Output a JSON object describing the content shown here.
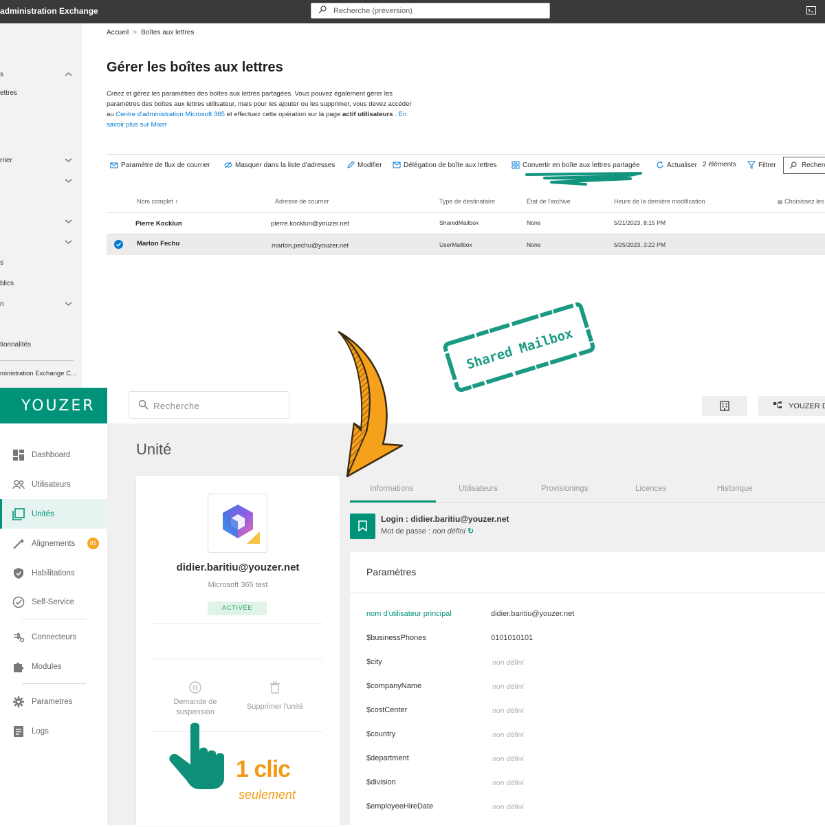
{
  "exchange": {
    "app_title": "administration Exchange",
    "search_placeholder": "Recherche (préversion)",
    "sidebar_items": [
      {
        "label": "s",
        "chevron": true
      },
      {
        "label": "ettres",
        "chevron": false
      },
      {
        "label": "rrier",
        "chevron": true
      },
      {
        "label": "",
        "chevron": true
      },
      {
        "label": "",
        "chevron": true
      },
      {
        "label": "",
        "chevron": true
      },
      {
        "label": "s",
        "chevron": false
      },
      {
        "label": "blics",
        "chevron": false
      },
      {
        "label": "n",
        "chevron": true
      },
      {
        "label": "tionnalités",
        "chevron": false
      },
      {
        "label": "ministration Exchange C...",
        "chevron": false
      }
    ],
    "breadcrumb": [
      "Accueil",
      ">",
      "Boîtes aux lettres"
    ],
    "page_title": "Gérer les boîtes aux lettres",
    "description": {
      "p1": "Créez et gérez les paramètres des boîtes aux lettres partagées. Vous pouvez également gérer les paramètres des boîtes aux lettres utilisateur, mais pour les ajouter ou les supprimer, vous devez accéder au ",
      "link1": "Centre d'administration Microsoft 365",
      "p2": " et effectuez cette opération sur la page ",
      "bold1": "actif utilisateurs",
      "p3": " . ",
      "link2": "En savoir plus sur Mixer"
    },
    "commands": [
      {
        "icon": "mail-flow-icon",
        "label": "Paramètre de flux de courrier"
      },
      {
        "icon": "hide-icon",
        "label": "Masquer dans la liste d'adresses"
      },
      {
        "icon": "edit-icon",
        "label": "Modifier"
      },
      {
        "icon": "delegation-icon",
        "label": "Délégation de boîte aux lettres"
      },
      {
        "icon": "convert-icon",
        "label": "Convertir en boîte aux lettres partagée"
      },
      {
        "icon": "refresh-icon",
        "label": "Actualiser"
      },
      {
        "icon": "",
        "label": "2 éléments"
      },
      {
        "icon": "filter-icon",
        "label": "Filtrer"
      }
    ],
    "table_search_placeholder": "Recherc",
    "columns": [
      "Nom complet",
      "Adresse de courrier",
      "Type de destinataire",
      "État de l'archive",
      "Heure de la dernière modification",
      "Choisissez les"
    ],
    "rows": [
      {
        "name": "Pierre Kocklun",
        "email": "pierre.kocklun@youzer.net",
        "type": "SharedMailbox",
        "archive": "None",
        "modified": "5/21/2023, 8:15 PM",
        "selected": false
      },
      {
        "name": "Marlon Fechu",
        "email": "marlon.pechu@youzer.net",
        "type": "UserMailbox",
        "archive": "None",
        "modified": "5/25/2023, 3:22 PM",
        "selected": true
      }
    ]
  },
  "annotations": {
    "stamp_text": "Shared Mailbox",
    "stamp_color": "#1a9a82",
    "arrow_color": "#f5a11c",
    "click_big": "1 clic",
    "click_small": "seulement",
    "hand_color": "#0e8f7a"
  },
  "youzer": {
    "logo": "YOUZER",
    "brand_color": "#00937a",
    "search_placeholder": "Recherche",
    "top_button": "YOUZER D",
    "nav": [
      {
        "icon": "dashboard-icon",
        "label": "Dashboard",
        "active": false
      },
      {
        "icon": "users-icon",
        "label": "Utilisateurs",
        "active": false
      },
      {
        "icon": "units-icon",
        "label": "Unités",
        "active": true
      },
      {
        "icon": "magic-wand-icon",
        "label": "Alignements",
        "active": false,
        "badge": "81"
      },
      {
        "icon": "shield-icon",
        "label": "Habilitations",
        "active": false
      },
      {
        "icon": "check-circle-icon",
        "label": "Self-Service",
        "active": false
      },
      {
        "icon": "connector-icon",
        "label": "Connecteurs",
        "active": false
      },
      {
        "icon": "puzzle-icon",
        "label": "Modules",
        "active": false
      },
      {
        "icon": "gear-icon",
        "label": "Parametres",
        "active": false
      },
      {
        "icon": "logs-icon",
        "label": "Logs",
        "active": false
      }
    ],
    "page_title": "Unité",
    "card": {
      "email": "didier.baritiu@youzer.net",
      "subtitle": "Microsoft 365 test",
      "status": "ACTIVÉE",
      "action_suspend": "Demande de suspension",
      "action_delete": "Supprimer l'unité"
    },
    "tabs": [
      "Informations",
      "Utilisateurs",
      "Provisionings",
      "Licences",
      "Historique"
    ],
    "active_tab": "Informations",
    "login_label": "Login : didier.baritiu@youzer.net",
    "password_prefix": "Mot de passe : ",
    "password_value": "non défini",
    "params_title": "Paramètres",
    "params": [
      {
        "key": "nom d'utilisateur principal",
        "value": "didier.baritiu@youzer.net",
        "accent": true,
        "defined": true
      },
      {
        "key": "$businessPhones",
        "value": "0101010101",
        "accent": false,
        "defined": true
      },
      {
        "key": "$city",
        "value": "non défini",
        "accent": false,
        "defined": false
      },
      {
        "key": "$companyName",
        "value": "non défini",
        "accent": false,
        "defined": false
      },
      {
        "key": "$costCenter",
        "value": "non défini",
        "accent": false,
        "defined": false
      },
      {
        "key": "$country",
        "value": "non défini",
        "accent": false,
        "defined": false
      },
      {
        "key": "$department",
        "value": "non défini",
        "accent": false,
        "defined": false
      },
      {
        "key": "$division",
        "value": "non défini",
        "accent": false,
        "defined": false
      },
      {
        "key": "$employeeHireDate",
        "value": "non défini",
        "accent": false,
        "defined": false
      }
    ]
  }
}
